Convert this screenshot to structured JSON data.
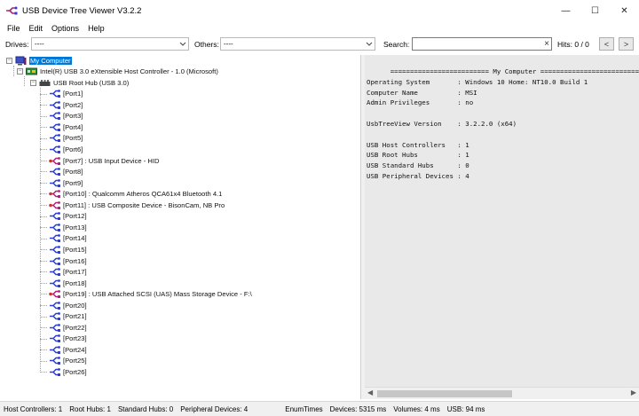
{
  "window": {
    "title": "USB Device Tree Viewer V3.2.2",
    "app_icon": "usb-tree-app-icon",
    "controls": {
      "minimize": "—",
      "maximize": "☐",
      "close": "✕"
    }
  },
  "menu": [
    "File",
    "Edit",
    "Options",
    "Help"
  ],
  "toolbar": {
    "drives_label": "Drives:",
    "drives_value": "----",
    "others_label": "Others:",
    "others_value": "----",
    "search_label": "Search:",
    "search_value": "",
    "hits_label": "Hits: 0 / 0",
    "prev_label": "<",
    "next_label": ">"
  },
  "tree": {
    "root": "My Computer",
    "controller": "Intel(R) USB 3.0 eXtensible Host Controller - 1.0 (Microsoft)",
    "hub": "USB Root Hub (USB 3.0)",
    "ports": [
      {
        "label": "[Port1]",
        "device": false
      },
      {
        "label": "[Port2]",
        "device": false
      },
      {
        "label": "[Port3]",
        "device": false
      },
      {
        "label": "[Port4]",
        "device": false
      },
      {
        "label": "[Port5]",
        "device": false
      },
      {
        "label": "[Port6]",
        "device": false
      },
      {
        "label": "[Port7] : USB Input Device - HID",
        "device": true
      },
      {
        "label": "[Port8]",
        "device": false
      },
      {
        "label": "[Port9]",
        "device": false
      },
      {
        "label": "[Port10] : Qualcomm Atheros QCA61x4 Bluetooth 4.1",
        "device": true
      },
      {
        "label": "[Port11] : USB Composite Device - BisonCam, NB Pro",
        "device": true
      },
      {
        "label": "[Port12]",
        "device": false
      },
      {
        "label": "[Port13]",
        "device": false
      },
      {
        "label": "[Port14]",
        "device": false
      },
      {
        "label": "[Port15]",
        "device": false
      },
      {
        "label": "[Port16]",
        "device": false
      },
      {
        "label": "[Port17]",
        "device": false
      },
      {
        "label": "[Port18]",
        "device": false
      },
      {
        "label": "[Port19] : USB Attached SCSI (UAS) Mass Storage Device - F:\\",
        "device": true
      },
      {
        "label": "[Port20]",
        "device": false
      },
      {
        "label": "[Port21]",
        "device": false
      },
      {
        "label": "[Port22]",
        "device": false
      },
      {
        "label": "[Port23]",
        "device": false
      },
      {
        "label": "[Port24]",
        "device": false
      },
      {
        "label": "[Port25]",
        "device": false
      },
      {
        "label": "[Port26]",
        "device": false
      }
    ]
  },
  "info": {
    "lines": [
      "      ========================= My Computer ==========================",
      "Operating System       : Windows 10 Home: NT10.0 Build 1",
      "Computer Name          : MSI",
      "Admin Privileges       : no",
      "",
      "UsbTreeView Version    : 3.2.2.0 (x64)",
      "",
      "USB Host Controllers   : 1",
      "USB Root Hubs          : 1",
      "USB Standard Hubs      : 0",
      "USB Peripheral Devices : 4"
    ]
  },
  "status": {
    "host_controllers": "Host Controllers: 1",
    "root_hubs": "Root Hubs: 1",
    "standard_hubs": "Standard Hubs: 0",
    "peripheral_devices": "Peripheral Devices: 4",
    "enum_times": "EnumTimes",
    "devices_time": "Devices: 5315 ms",
    "volumes_time": "Volumes: 4 ms",
    "usb_time": "USB: 94 ms"
  },
  "colors": {
    "selection": "#0078d7",
    "usb_port_icon": "#2b3fd6",
    "usb_device_icon": "#b0207e",
    "info_bg": "#e9e9e9"
  }
}
